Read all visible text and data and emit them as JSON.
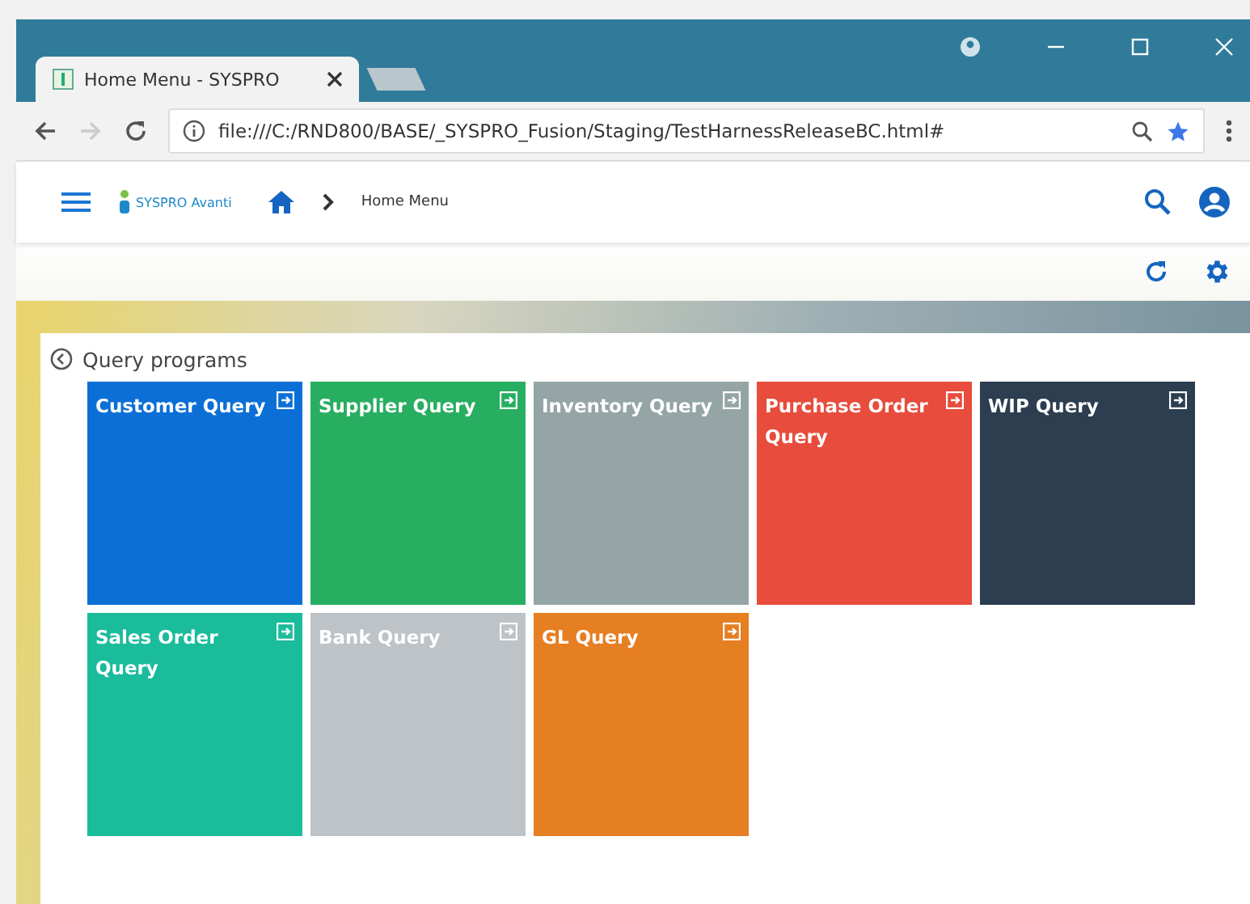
{
  "browser": {
    "tab_title": "Home Menu - SYSPRO",
    "url": "file:///C:/RND800/BASE/_SYSPRO_Fusion/Staging/TestHarnessReleaseBC.html#"
  },
  "app_header": {
    "logo_text": "SYSPRO Avanti",
    "breadcrumb": "Home Menu"
  },
  "panel": {
    "title": "Query programs",
    "tiles": [
      {
        "label": "Customer Query",
        "color": "#0b6fd6"
      },
      {
        "label": "Supplier Query",
        "color": "#27ae60"
      },
      {
        "label": "Inventory Query",
        "color": "#95a5a6"
      },
      {
        "label": "Purchase Order Query",
        "color": "#e74c3c"
      },
      {
        "label": "WIP Query",
        "color": "#2c3e50"
      },
      {
        "label": "Sales Order Query",
        "color": "#1abc9c"
      },
      {
        "label": "Bank Query",
        "color": "#bdc3c7"
      },
      {
        "label": "GL Query",
        "color": "#e67e22"
      }
    ]
  }
}
